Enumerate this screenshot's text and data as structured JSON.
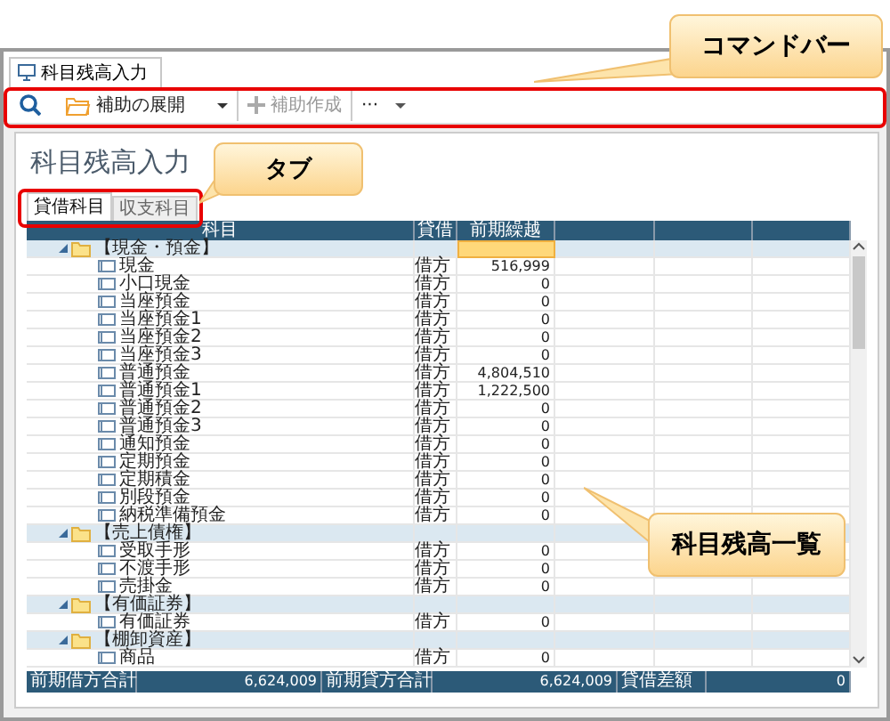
{
  "window_tab": {
    "label": "科目残高入力"
  },
  "command_bar": [
    {
      "kind": "search",
      "disabled": false
    },
    {
      "kind": "expand",
      "label": "補助の展開",
      "disabled": false
    },
    {
      "kind": "create",
      "label": "補助作成",
      "disabled": true
    },
    {
      "kind": "more",
      "label": "···",
      "disabled": false
    }
  ],
  "title": "科目残高入力",
  "tabs": [
    {
      "label": "貸借科目",
      "selected": true
    },
    {
      "label": "収支科目",
      "selected": false
    }
  ],
  "table": {
    "columns": [
      "科目",
      "貸借",
      "前期繰越"
    ],
    "groups": [
      {
        "name": "【現金・預金】",
        "expanded": true,
        "focused": true,
        "children": [
          {
            "name": "現金",
            "side": "借方",
            "balance": "516,999"
          },
          {
            "name": "小口現金",
            "side": "借方",
            "balance": "0"
          },
          {
            "name": "当座預金",
            "side": "借方",
            "balance": "0"
          },
          {
            "name": "当座預金1",
            "side": "借方",
            "balance": "0"
          },
          {
            "name": "当座預金2",
            "side": "借方",
            "balance": "0"
          },
          {
            "name": "当座預金3",
            "side": "借方",
            "balance": "0"
          },
          {
            "name": "普通預金",
            "side": "借方",
            "balance": "4,804,510"
          },
          {
            "name": "普通預金1",
            "side": "借方",
            "balance": "1,222,500"
          },
          {
            "name": "普通預金2",
            "side": "借方",
            "balance": "0"
          },
          {
            "name": "普通預金3",
            "side": "借方",
            "balance": "0"
          },
          {
            "name": "通知預金",
            "side": "借方",
            "balance": "0"
          },
          {
            "name": "定期預金",
            "side": "借方",
            "balance": "0"
          },
          {
            "name": "定期積金",
            "side": "借方",
            "balance": "0"
          },
          {
            "name": "別段預金",
            "side": "借方",
            "balance": "0"
          },
          {
            "name": "納税準備預金",
            "side": "借方",
            "balance": "0"
          }
        ]
      },
      {
        "name": "【売上債権】",
        "expanded": true,
        "focused": false,
        "children": [
          {
            "name": "受取手形",
            "side": "借方",
            "balance": "0"
          },
          {
            "name": "不渡手形",
            "side": "借方",
            "balance": "0"
          },
          {
            "name": "売掛金",
            "side": "借方",
            "balance": "0"
          }
        ]
      },
      {
        "name": "【有価証券】",
        "expanded": true,
        "focused": false,
        "children": [
          {
            "name": "有価証券",
            "side": "借方",
            "balance": "0"
          }
        ]
      },
      {
        "name": "【棚卸資産】",
        "expanded": true,
        "focused": false,
        "children": [
          {
            "name": "商品",
            "side": "借方",
            "balance": "0"
          }
        ]
      }
    ]
  },
  "footer": [
    {
      "label": "前期借方合計",
      "value": "6,624,009"
    },
    {
      "label": "前期貸方合計",
      "value": "6,624,009"
    },
    {
      "label": "貸借差額",
      "value": "0"
    }
  ],
  "callouts": [
    {
      "kind": "command_bar",
      "text": "コマンドバー",
      "highlight": true
    },
    {
      "kind": "tabs",
      "text": "タブ",
      "highlight": true
    },
    {
      "kind": "table",
      "text": "科目残高一覧",
      "highlight": false
    }
  ]
}
